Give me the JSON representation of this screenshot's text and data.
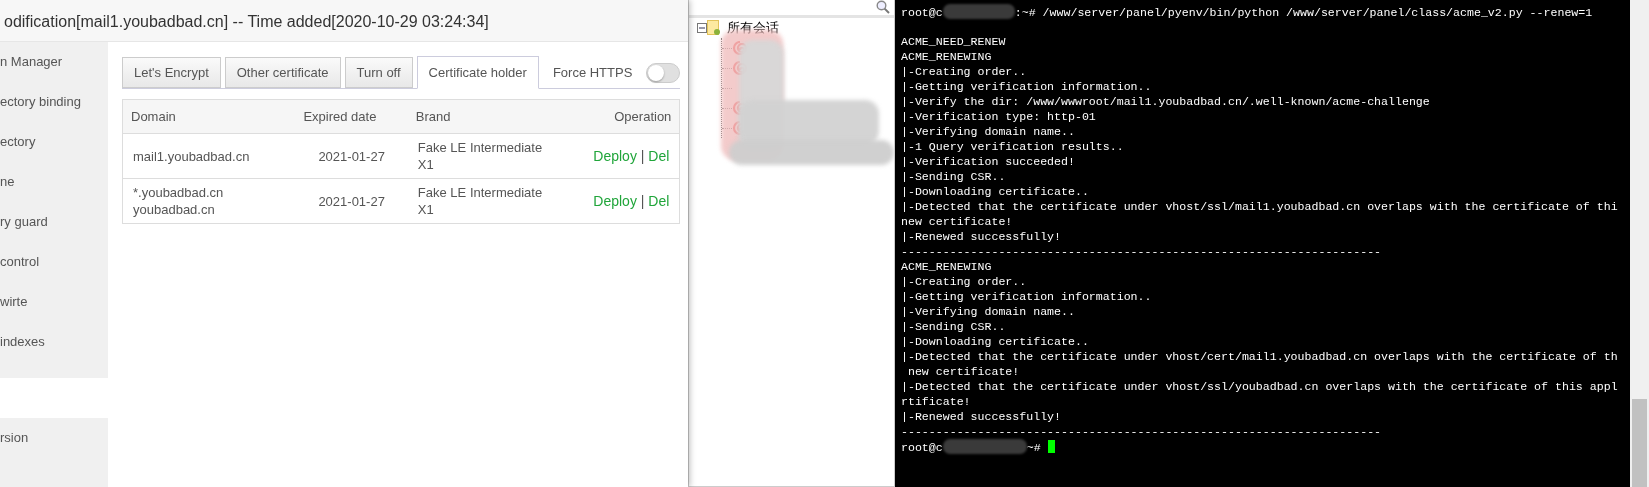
{
  "dialog": {
    "title": "odification[mail1.youbadbad.cn] -- Time added[2020-10-29 03:24:34]",
    "sidebar": {
      "groups": [
        [
          "n Manager",
          "ectory binding",
          "ectory",
          "ne",
          "ry guard",
          "control",
          "wirte",
          "indexes"
        ],
        [
          "rsion"
        ]
      ]
    },
    "tabs": [
      {
        "label": "Let's Encrypt",
        "selected": false
      },
      {
        "label": "Other certificate",
        "selected": false
      },
      {
        "label": "Turn off",
        "selected": false
      },
      {
        "label": "Certificate holder",
        "selected": true
      }
    ],
    "force_https": {
      "label": "Force HTTPS",
      "on": false
    },
    "table": {
      "columns": [
        "Domain",
        "Expired date",
        "Brand",
        "Operation"
      ],
      "rows": [
        {
          "domains": [
            "mail1.youbadbad.cn"
          ],
          "expired": "2021-01-27",
          "brand": "Fake LE Intermediate X1",
          "actions": [
            "Deploy",
            "Del"
          ],
          "separator": "|"
        },
        {
          "domains": [
            "*.youbadbad.cn",
            "youbadbad.cn"
          ],
          "expired": "2021-01-27",
          "brand": "Fake LE Intermediate X1",
          "actions": [
            "Deploy",
            "Del"
          ],
          "separator": "|"
        }
      ]
    }
  },
  "session_tree": {
    "root": {
      "label": "所有会话",
      "expanded": true,
      "children": [
        {
          "kind": "session"
        },
        {
          "kind": "session"
        },
        {
          "kind": "hidden"
        },
        {
          "kind": "session"
        },
        {
          "kind": "session"
        }
      ]
    }
  },
  "terminal": {
    "lines": [
      {
        "kind": "prompt",
        "user": "root@c",
        "suffix": ":~#",
        "command": "/www/server/panel/pyenv/bin/python /www/server/panel/class/acme_v2.py --renew=1",
        "cursor": false
      },
      {
        "kind": "blank"
      },
      {
        "kind": "output",
        "text": "ACME_NEED_RENEW"
      },
      {
        "kind": "output",
        "text": "ACME_RENEWING"
      },
      {
        "kind": "output",
        "text": "|-Creating order.."
      },
      {
        "kind": "output",
        "text": "|-Getting verification information.."
      },
      {
        "kind": "output",
        "text": "|-Verify the dir: /www/wwwroot/mail1.youbadbad.cn/.well-known/acme-challenge"
      },
      {
        "kind": "output",
        "text": "|-Verification type: http-01"
      },
      {
        "kind": "output",
        "text": "|-Verifying domain name.."
      },
      {
        "kind": "output",
        "text": "|-1 Query verification results.."
      },
      {
        "kind": "output",
        "text": "|-Verification succeeded!"
      },
      {
        "kind": "output",
        "text": "|-Sending CSR.."
      },
      {
        "kind": "output",
        "text": "|-Downloading certificate.."
      },
      {
        "kind": "output",
        "text": "|-Detected that the certificate under vhost/ssl/mail1.youbadbad.cn overlaps with the certificate of thi"
      },
      {
        "kind": "output",
        "text": "new certificate!"
      },
      {
        "kind": "output",
        "text": "|-Renewed successfully!"
      },
      {
        "kind": "output",
        "text": "---------------------------------------------------------------------"
      },
      {
        "kind": "output",
        "text": "ACME_RENEWING"
      },
      {
        "kind": "output",
        "text": "|-Creating order.."
      },
      {
        "kind": "output",
        "text": "|-Getting verification information.."
      },
      {
        "kind": "output",
        "text": "|-Verifying domain name.."
      },
      {
        "kind": "output",
        "text": "|-Sending CSR.."
      },
      {
        "kind": "output",
        "text": "|-Downloading certificate.."
      },
      {
        "kind": "output",
        "text": "|-Detected that the certificate under vhost/cert/mail1.youbadbad.cn overlaps with the certificate of th"
      },
      {
        "kind": "output",
        "text": " new certificate!"
      },
      {
        "kind": "output",
        "text": "|-Detected that the certificate under vhost/ssl/youbadbad.cn overlaps with the certificate of this appl"
      },
      {
        "kind": "output",
        "text": "rtificate!"
      },
      {
        "kind": "output",
        "text": "|-Renewed successfully!"
      },
      {
        "kind": "output",
        "text": "---------------------------------------------------------------------"
      },
      {
        "kind": "prompt",
        "user": "root@c",
        "suffix": "~#",
        "cursor": true
      }
    ]
  }
}
